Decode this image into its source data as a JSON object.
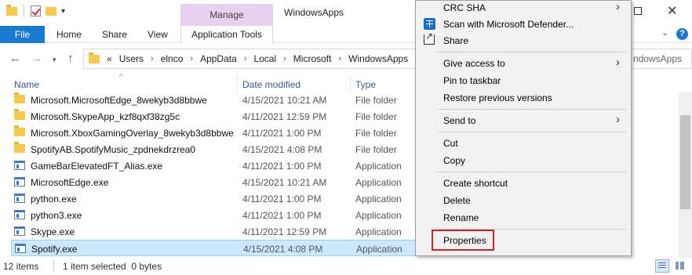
{
  "window": {
    "title": "WindowsApps",
    "manage_label": "Manage"
  },
  "ribbon": {
    "tabs": [
      {
        "label": "File"
      },
      {
        "label": "Home"
      },
      {
        "label": "Share"
      },
      {
        "label": "View"
      },
      {
        "label": "Application Tools"
      }
    ]
  },
  "address": {
    "overflow": "«",
    "crumbs": [
      "Users",
      "elnco",
      "AppData",
      "Local",
      "Microsoft",
      "WindowsApps"
    ],
    "search_partial": "ndowsApps"
  },
  "columns": {
    "name": "Name",
    "date": "Date modified",
    "type": "Type"
  },
  "files": [
    {
      "name": "Microsoft.MicrosoftEdge_8wekyb3d8bbwe",
      "date": "4/15/2021 10:21 AM",
      "type": "File folder",
      "icon": "folder-icon"
    },
    {
      "name": "Microsoft.SkypeApp_kzf8qxf38zg5c",
      "date": "4/11/2021 12:59 PM",
      "type": "File folder",
      "icon": "folder-icon"
    },
    {
      "name": "Microsoft.XboxGamingOverlay_8wekyb3d8bbwe",
      "date": "4/11/2021 1:00 PM",
      "type": "File folder",
      "icon": "folder-icon"
    },
    {
      "name": "SpotifyAB.SpotifyMusic_zpdnekdrzrea0",
      "date": "4/15/2021 4:08 PM",
      "type": "File folder",
      "icon": "folder-icon"
    },
    {
      "name": "GameBarElevatedFT_Alias.exe",
      "date": "4/11/2021 1:00 PM",
      "type": "Application",
      "icon": "app-icon"
    },
    {
      "name": "MicrosoftEdge.exe",
      "date": "4/15/2021 10:21 AM",
      "type": "Application",
      "icon": "app-icon"
    },
    {
      "name": "python.exe",
      "date": "4/11/2021 1:00 PM",
      "type": "Application",
      "icon": "app-icon"
    },
    {
      "name": "python3.exe",
      "date": "4/11/2021 1:00 PM",
      "type": "Application",
      "icon": "app-icon"
    },
    {
      "name": "Skype.exe",
      "date": "4/11/2021 12:59 PM",
      "type": "Application",
      "icon": "app-icon"
    },
    {
      "name": "Spotify.exe",
      "date": "4/15/2021 4:08 PM",
      "type": "Application",
      "icon": "app-icon",
      "selected": true
    }
  ],
  "status": {
    "count": "12 items",
    "selected": "1 item selected  0 bytes"
  },
  "context_menu": {
    "items": [
      {
        "label": "CRC SHA",
        "has_submenu": true
      },
      {
        "label": "Scan with Microsoft Defender...",
        "icon": "defender-icon"
      },
      {
        "label": "Share",
        "icon": "share-icon"
      },
      {
        "label": "Give access to",
        "has_submenu": true
      },
      {
        "label": "Pin to taskbar"
      },
      {
        "label": "Restore previous versions"
      },
      {
        "label": "Send to",
        "has_submenu": true
      },
      {
        "label": "Cut"
      },
      {
        "label": "Copy"
      },
      {
        "label": "Create shortcut"
      },
      {
        "label": "Delete"
      },
      {
        "label": "Rename"
      },
      {
        "label": "Properties",
        "highlighted": true
      }
    ]
  },
  "colors": {
    "file_tab": "#1979ca",
    "manage_tab": "#e8d0f0",
    "selection": "#cce8ff",
    "highlight_box": "#d0202a"
  }
}
